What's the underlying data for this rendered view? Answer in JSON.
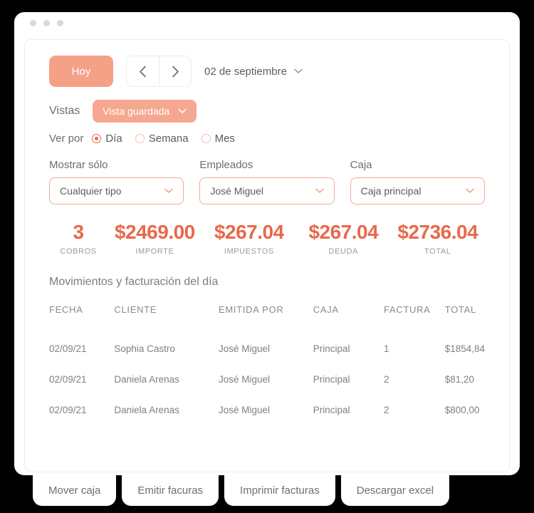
{
  "window": {
    "traffic_lights": [
      "dot-1",
      "dot-2",
      "dot-3"
    ]
  },
  "toolbar": {
    "today_label": "Hoy",
    "prev_icon": "chevron-left-icon",
    "next_icon": "chevron-right-icon",
    "current_date": "02 de septiembre",
    "date_chevron_icon": "chevron-down-icon"
  },
  "views": {
    "label": "Vistas",
    "saved_view_label": "Vista guardada",
    "saved_view_chevron_icon": "chevron-down-icon"
  },
  "view_by": {
    "label": "Ver por",
    "options": [
      {
        "label": "Día",
        "selected": true
      },
      {
        "label": "Semana",
        "selected": false
      },
      {
        "label": "Mes",
        "selected": false
      }
    ]
  },
  "filters": [
    {
      "label": "Mostrar sólo",
      "value": "Cualquier tipo",
      "chevron_icon": "chevron-down-icon"
    },
    {
      "label": "Empleados",
      "value": "José Miguel",
      "chevron_icon": "chevron-down-icon"
    },
    {
      "label": "Caja",
      "value": "Caja principal",
      "chevron_icon": "chevron-down-icon"
    }
  ],
  "stats": [
    {
      "value": "3",
      "label": "COBROS"
    },
    {
      "value": "$2469.00",
      "label": "IMPORTE"
    },
    {
      "value": "$267.04",
      "label": "IMPUESTOS"
    },
    {
      "value": "$267.04",
      "label": "DEUDA"
    },
    {
      "value": "$2736.04",
      "label": "TOTAL"
    }
  ],
  "table": {
    "title": "Movimientos y facturación del día",
    "columns": [
      "FECHA",
      "CLIENTE",
      "EMITIDA POR",
      "CAJA",
      "FACTURA",
      "TOTAL"
    ],
    "rows": [
      {
        "fecha": "02/09/21",
        "cliente": "Sophia Castro",
        "emitida_por": "José Miguel",
        "caja": "Principal",
        "factura": "1",
        "total": "$1854,84"
      },
      {
        "fecha": "02/09/21",
        "cliente": "Daniela Arenas",
        "emitida_por": "José Miguel",
        "caja": "Principal",
        "factura": "2",
        "total": "$81,20"
      },
      {
        "fecha": "02/09/21",
        "cliente": "Daniela Arenas",
        "emitida_por": "José Miguel",
        "caja": "Principal",
        "factura": "2",
        "total": "$800,00"
      }
    ]
  },
  "bottom_actions": [
    {
      "label": "Mover caja"
    },
    {
      "label": "Emitir facuras"
    },
    {
      "label": "Imprimir facturas"
    },
    {
      "label": "Descargar excel"
    }
  ],
  "colors": {
    "accent": "#e8694a",
    "accent_soft": "#f4a188",
    "accent_border": "#eeab93",
    "text_muted": "#8b8b8b",
    "background": "#000000"
  }
}
